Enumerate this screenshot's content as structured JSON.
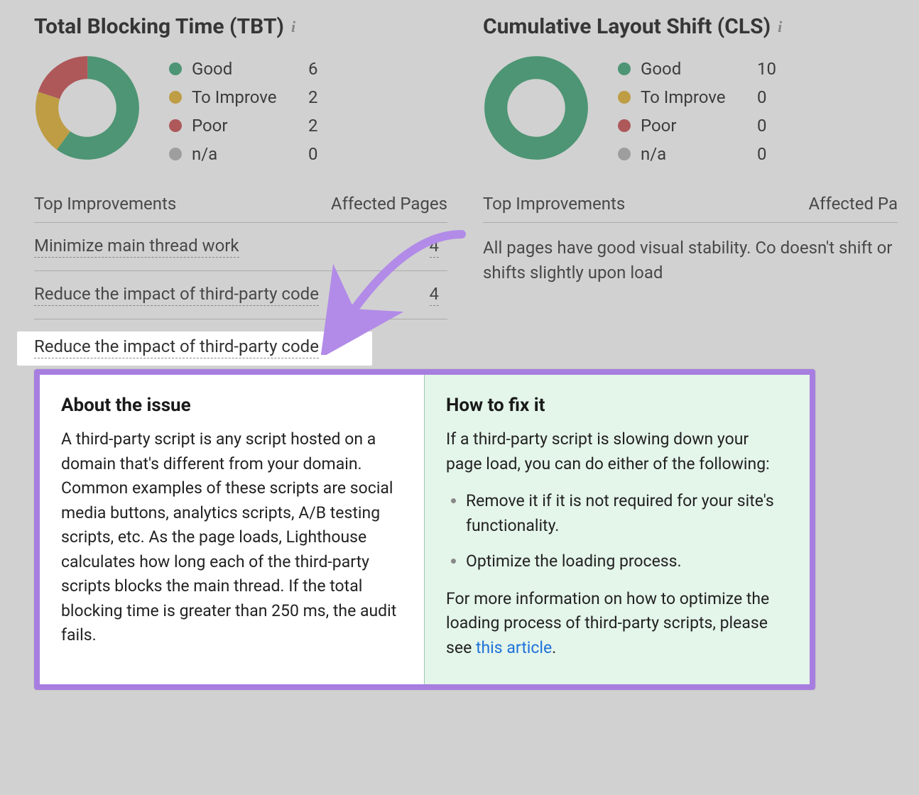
{
  "colors": {
    "good": "#3a9d6f",
    "improve": "#d6a82d",
    "poor": "#c0494c",
    "na": "#aaaaaa",
    "accent_border": "#a77ee0",
    "fix_bg": "#e4f5ea",
    "link": "#1e72d8"
  },
  "chart_data": [
    {
      "type": "pie",
      "title": "Total Blocking Time (TBT)",
      "categories": [
        "Good",
        "To Improve",
        "Poor",
        "n/a"
      ],
      "values": [
        6,
        2,
        2,
        0
      ]
    },
    {
      "type": "pie",
      "title": "Cumulative Layout Shift (CLS)",
      "categories": [
        "Good",
        "To Improve",
        "Poor",
        "n/a"
      ],
      "values": [
        10,
        0,
        0,
        0
      ]
    }
  ],
  "tbt": {
    "title": "Total Blocking Time (TBT)",
    "legend": {
      "good_label": "Good",
      "good_value": "6",
      "improve_label": "To Improve",
      "improve_value": "2",
      "poor_label": "Poor",
      "poor_value": "2",
      "na_label": "n/a",
      "na_value": "0"
    },
    "improvements_header_left": "Top Improvements",
    "improvements_header_right": "Affected Pages",
    "rows": [
      {
        "label": "Minimize main thread work",
        "count": "4"
      },
      {
        "label": "Reduce the impact of third-party code",
        "count": "4"
      }
    ]
  },
  "cls": {
    "title": "Cumulative Layout Shift (CLS)",
    "legend": {
      "good_label": "Good",
      "good_value": "10",
      "improve_label": "To Improve",
      "improve_value": "0",
      "poor_label": "Poor",
      "poor_value": "0",
      "na_label": "n/a",
      "na_value": "0"
    },
    "improvements_header_left": "Top Improvements",
    "improvements_header_right": "Affected Pa",
    "note": "All pages have good visual stability. Co doesn't shift or shifts slightly upon load"
  },
  "popup": {
    "about_title": "About the issue",
    "about_body": "A third-party script is any script hosted on a domain that's different from your domain. Common examples of these scripts are social media buttons, analytics scripts, A/B testing scripts, etc. As the page loads, Lighthouse calculates how long each of the third-party scripts blocks the main thread. If the total blocking time is greater than 250 ms, the audit fails.",
    "fix_title": "How to fix it",
    "fix_intro": "If a third-party script is slowing down your page load, you can do either of the following:",
    "fix_items": [
      "Remove it if it is not required for your site's functionality.",
      "Optimize the loading process."
    ],
    "fix_outro_pre": "For more information on how to optimize the loading process of third-party scripts, please see ",
    "fix_link": "this article",
    "fix_outro_post": "."
  }
}
